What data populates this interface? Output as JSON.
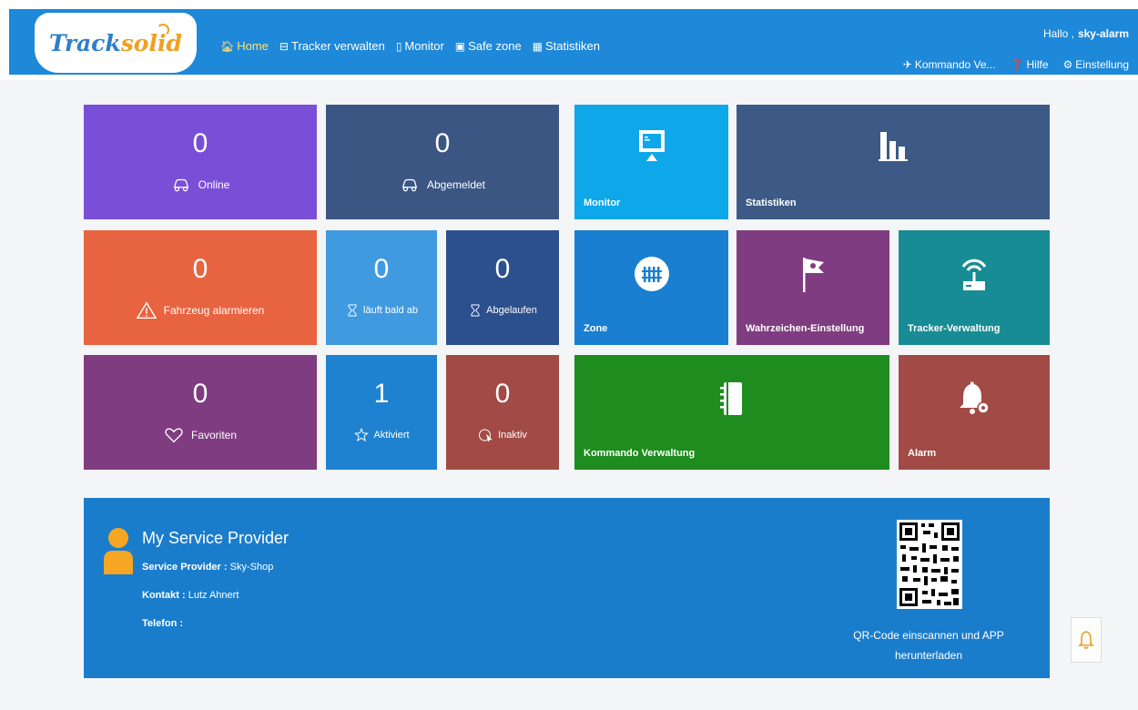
{
  "header": {
    "logo_text_main": "Track",
    "logo_text_accent": "solid",
    "nav": [
      {
        "label": "Home",
        "icon": "home-icon",
        "active": true
      },
      {
        "label": "Tracker verwalten",
        "icon": "tracker-icon"
      },
      {
        "label": "Monitor",
        "icon": "map-icon"
      },
      {
        "label": "Safe zone",
        "icon": "safezone-icon"
      },
      {
        "label": "Statistiken",
        "icon": "table-icon"
      }
    ],
    "greeting": "Hallo ,",
    "username": "sky-alarm",
    "right_links": [
      {
        "label": "Kommando Ve...",
        "icon": "send-icon"
      },
      {
        "label": "Hilfe",
        "icon": "help-icon"
      },
      {
        "label": "Einstellung",
        "icon": "gear-icon"
      }
    ]
  },
  "tiles": {
    "online": {
      "value": "0",
      "label": "Online",
      "color": "#7a4fd8"
    },
    "abgemeldet": {
      "value": "0",
      "label": "Abgemeldet",
      "color": "#3b5683"
    },
    "fahrzeug": {
      "value": "0",
      "label": "Fahrzeug alarmieren",
      "color": "#e8633f"
    },
    "laeuft": {
      "value": "0",
      "label": "läuft bald ab",
      "color": "#3f9ae0"
    },
    "abgelaufen": {
      "value": "0",
      "label": "Abgelaufen",
      "color": "#2c4f8e"
    },
    "favoriten": {
      "value": "0",
      "label": "Favoriten",
      "color": "#7f3c80"
    },
    "aktiviert": {
      "value": "1",
      "label": "Aktiviert",
      "color": "#1f82d0"
    },
    "inaktiv": {
      "value": "0",
      "label": "Inaktiv",
      "color": "#a24a45"
    },
    "monitor": {
      "label": "Monitor",
      "color": "#0ea7ea"
    },
    "statistiken": {
      "label": "Statistiken",
      "color": "#3c5a85"
    },
    "zone": {
      "label": "Zone",
      "color": "#1a7fd0"
    },
    "wahrzeichen": {
      "label": "Wahrzeichen-Einstellung",
      "color": "#7f3c80"
    },
    "tracker_verwaltung": {
      "label": "Tracker-Verwaltung",
      "color": "#188c94"
    },
    "kommando": {
      "label": "Kommando Verwaltung",
      "color": "#1e8c1e"
    },
    "alarm": {
      "label": "Alarm",
      "color": "#a24a45"
    }
  },
  "service": {
    "title": "My Service Provider",
    "provider_label": "Service Provider :",
    "provider_value": "Sky-Shop",
    "contact_label": "Kontakt :",
    "contact_value": "Lutz Ahnert",
    "phone_label": "Telefon :",
    "phone_value": "",
    "qr_text_1": "QR-Code einscannen und APP",
    "qr_text_2": "herunterladen"
  }
}
